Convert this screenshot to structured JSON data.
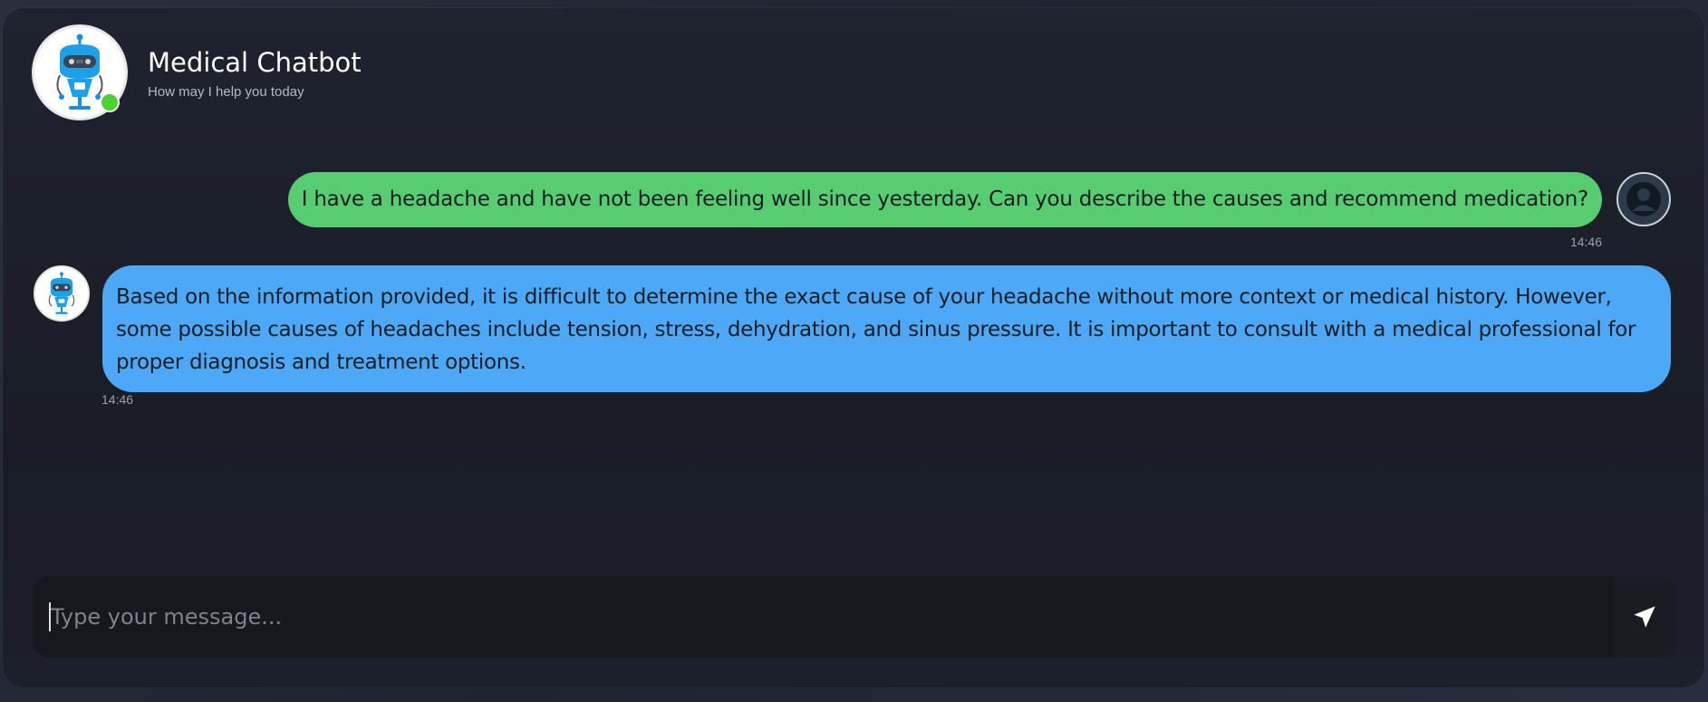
{
  "header": {
    "title": "Medical Chatbot",
    "subtitle": "How may I help you today",
    "status": "online"
  },
  "messages": [
    {
      "sender": "user",
      "text": "I have a headache and have not been feeling well since yesterday. Can you describe the causes and recommend medication?",
      "time": "14:46"
    },
    {
      "sender": "bot",
      "text": "Based on the information provided, it is difficult to determine the exact cause of your headache without more context or medical history. However, some possible causes of headaches include tension, stress, dehydration, and sinus pressure. It is important to consult with a medical professional for proper diagnosis and treatment options.",
      "time": "14:46"
    }
  ],
  "composer": {
    "value": "",
    "placeholder": "Type your message..."
  },
  "icons": {
    "bot_avatar": "robot-doctor-icon",
    "user_avatar": "user-silhouette-icon",
    "send": "paper-plane-icon"
  },
  "colors": {
    "user_bubble": "#58cc71",
    "bot_bubble": "#4ea8f8",
    "online": "#4cd137",
    "background": "#1f2330"
  }
}
